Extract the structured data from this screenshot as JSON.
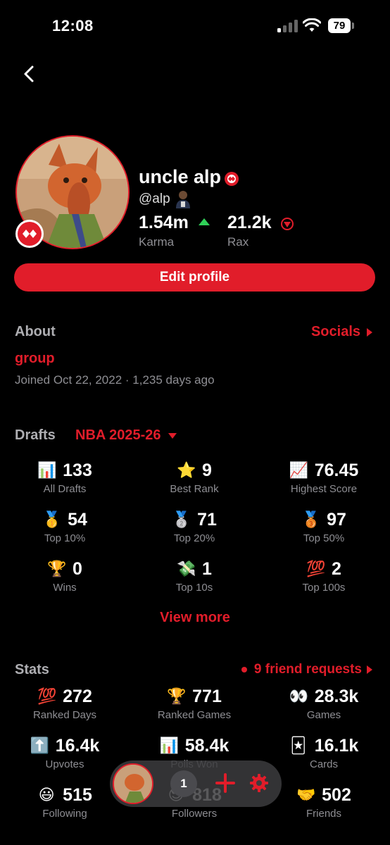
{
  "status_bar": {
    "time": "12:08",
    "battery": "79"
  },
  "profile": {
    "name": "uncle alp",
    "handle": "@alp",
    "karma_value": "1.54m",
    "karma_label": "Karma",
    "rax_value": "21.2k",
    "rax_label": "Rax",
    "edit_label": "Edit profile"
  },
  "about": {
    "title": "About",
    "socials_label": "Socials",
    "group": "group",
    "joined": "Joined Oct 22, 2022 · 1,235 days ago"
  },
  "drafts": {
    "title": "Drafts",
    "season": "NBA 2025-26",
    "items": [
      {
        "icon": "bar-chart-icon",
        "value": "133",
        "label": "All Drafts"
      },
      {
        "icon": "star-icon",
        "value": "9",
        "label": "Best Rank"
      },
      {
        "icon": "trending-up-chart-icon",
        "value": "76.45",
        "label": "Highest Score"
      },
      {
        "icon": "gold-medal-icon",
        "value": "54",
        "label": "Top 10%"
      },
      {
        "icon": "silver-medal-icon",
        "value": "71",
        "label": "Top 20%"
      },
      {
        "icon": "bronze-medal-icon",
        "value": "97",
        "label": "Top 50%"
      },
      {
        "icon": "trophy-icon",
        "value": "0",
        "label": "Wins"
      },
      {
        "icon": "money-wings-icon",
        "value": "1",
        "label": "Top 10s"
      },
      {
        "icon": "hundred-points-icon",
        "value": "2",
        "label": "Top 100s"
      }
    ],
    "view_more": "View more"
  },
  "stats": {
    "title": "Stats",
    "friend_requests": "9 friend requests",
    "items": [
      {
        "icon": "hundred-points-icon",
        "value": "272",
        "label": "Ranked Days"
      },
      {
        "icon": "trophy-icon",
        "value": "771",
        "label": "Ranked Games"
      },
      {
        "icon": "eyes-icon",
        "value": "28.3k",
        "label": "Games"
      },
      {
        "icon": "up-arrow-icon",
        "value": "16.4k",
        "label": "Upvotes"
      },
      {
        "icon": "bar-chart-icon",
        "value": "58.4k",
        "label": "Polls Won"
      },
      {
        "icon": "joker-card-icon",
        "value": "16.1k",
        "label": "Cards"
      },
      {
        "icon": "smiley-icon",
        "value": "515",
        "label": "Following"
      },
      {
        "icon": "sunglasses-face-icon",
        "value": "818",
        "label": "Followers"
      },
      {
        "icon": "handshake-icon",
        "value": "502",
        "label": "Friends"
      }
    ]
  },
  "floating_bar": {
    "count": "1"
  },
  "colors": {
    "accent": "#e11d2a",
    "background": "#000000",
    "muted": "#8e8e93",
    "karma_up": "#30d158"
  }
}
